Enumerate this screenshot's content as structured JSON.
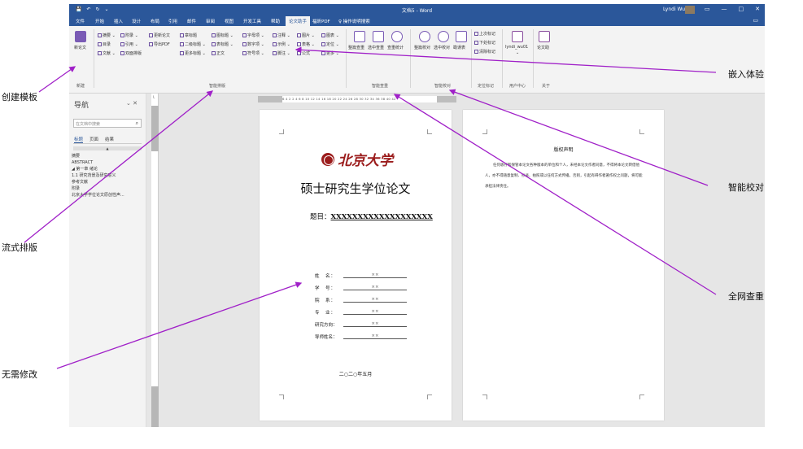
{
  "window": {
    "quick_access": [
      "💾",
      "↶",
      "↻",
      "⌄"
    ],
    "doc_title": "文档5 - Word",
    "user_name": "Lyndi Wu",
    "window_controls": [
      "▭",
      "—",
      "□",
      "✕"
    ]
  },
  "menubar": {
    "tabs": [
      "文件",
      "开始",
      "插入",
      "设计",
      "布局",
      "引用",
      "邮件",
      "审阅",
      "视图",
      "开发工具",
      "帮助",
      "论文助手",
      "福昕PDF",
      "操作说明搜索"
    ],
    "active_tab": "论文助手",
    "comment_icon": "comment-icon"
  },
  "ribbon": {
    "new_paper": "新论文",
    "new_group": "新建",
    "col1": [
      "摘要 ⌄",
      "目录",
      "文献 ⌄"
    ],
    "col2": [
      "附录 ⌄",
      "引用 ⌄",
      "双面排版"
    ],
    "col3": [
      "更新论文",
      "导出PDF",
      ""
    ],
    "col4": [
      "章标题",
      "二级标题 ⌄",
      "更多标题 ⌄"
    ],
    "col5": [
      "图标题 ⌄",
      "表标题 ⌄",
      "正文"
    ],
    "col6": [
      "字母项 ⌄",
      "数字项 ⌄",
      "符号项 ⌄"
    ],
    "col7": [
      "注释 ⌄",
      "示例 ⌄",
      "脚注 ⌄"
    ],
    "col8": [
      "图片 ⌄",
      "表格 ⌄",
      "公式"
    ],
    "col9": [
      "图表 ⌄",
      "定位 ⌄",
      "更多 ⌄"
    ],
    "layout_group": "智能排版",
    "check": [
      "整篇查重",
      "选中查重",
      "查重统计"
    ],
    "check_group": "智能查重",
    "proof": [
      "整篇校对",
      "选中校对",
      "勘误表"
    ],
    "proof_group": "智能校对",
    "mark": [
      "上次标记",
      "下处标记",
      "清除标记"
    ],
    "mark_group": "定位标记",
    "account": "lyndi_wu01",
    "account_sub": "⌄",
    "user_group": "用户中心",
    "help": "论文助",
    "about_group": "关于"
  },
  "nav": {
    "title": "导航",
    "controls": "⌄  ✕",
    "search_placeholder": "在文档中搜索",
    "tabs": [
      "标题",
      "页面",
      "结果"
    ],
    "scroll": "▲",
    "items": [
      "摘要",
      "ABSTRACT",
      "◢ 第一章  绪论",
      "   1.1  研究背景及研究意义",
      "参考文献",
      "附录",
      "北京大学学位论文原创性声..."
    ]
  },
  "ruler": {
    "v_marker": "└",
    "h_ticks": "6 4 2    2 4 6 8 10 12 14 16 18 20 22 24 26 28 30 32 34 36 38 40 42"
  },
  "page1": {
    "university": "北京大学",
    "title": "硕士研究生学位论文",
    "topic_label": "题目：",
    "topic_value": "XXXXXXXXXXXXXXXXXXX",
    "info": [
      {
        "label": "姓　名：",
        "value": "××"
      },
      {
        "label": "学　号：",
        "value": "××"
      },
      {
        "label": "院　系：",
        "value": "××"
      },
      {
        "label": "专　业：",
        "value": "××"
      },
      {
        "label": "研究方向：",
        "value": "××"
      },
      {
        "label": "导师姓名：",
        "value": "××"
      }
    ],
    "date": "二○二○年五月"
  },
  "page2": {
    "decl_title": "版权声明",
    "decl_body": "任何收存和保管本论文各种版本的单位和个人，未经本论文作者同意，不得将本论文转借他人，亦不得随意复制、抄录、拍照或以任何方式传播。否则，引起有碍作者著作权之问题，将可能承担法律责任。"
  },
  "annotations": {
    "template": "创建模板",
    "layout": "流式排版",
    "no_edit": "无需修改",
    "embed": "嵌入体验",
    "proof": "智能校对",
    "check": "全网查重"
  }
}
